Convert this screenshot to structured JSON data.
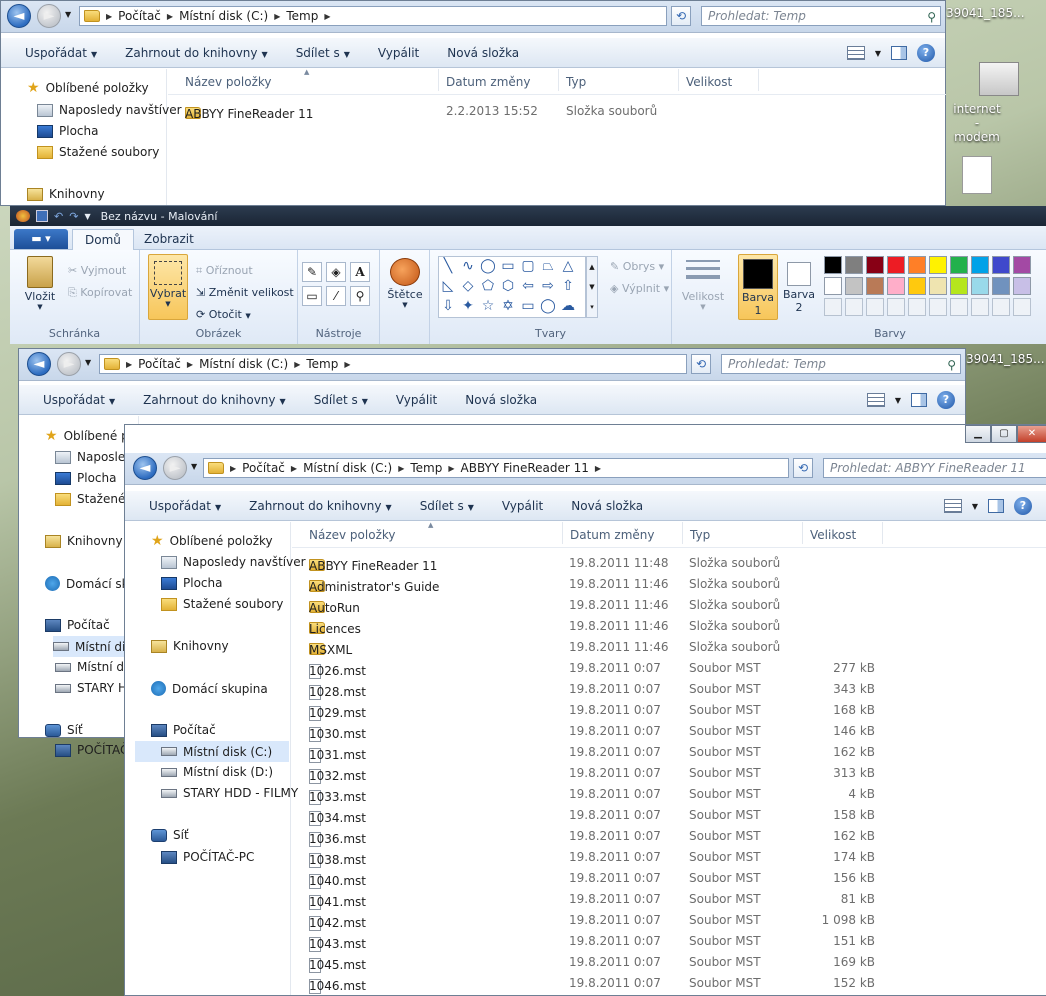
{
  "desktop": {
    "icon1_label": "internet -\nmodem",
    "fragment1": "39041_185...",
    "fragment2": "39041_185..."
  },
  "explorer1": {
    "path": [
      "Počítač",
      "Místní disk (C:)",
      "Temp"
    ],
    "search_placeholder": "Prohledat: Temp",
    "toolbar": [
      "Uspořádat",
      "Zahrnout do knihovny",
      "Sdílet s",
      "Vypálit",
      "Nová složka"
    ],
    "nav": [
      "Oblíbené položky",
      "Naposledy navštíver",
      "Plocha",
      "Stažené soubory",
      "Knihovny"
    ],
    "columns": [
      "Název položky",
      "Datum změny",
      "Typ",
      "Velikost"
    ],
    "rows": [
      {
        "name": "ABBYY FineReader 11",
        "date": "2.2.2013 15:52",
        "type": "Složka souborů",
        "size": ""
      }
    ]
  },
  "paint": {
    "title": "Bez názvu - Malování",
    "tabs": [
      "Domů",
      "Zobrazit"
    ],
    "groups": {
      "clipboard": {
        "label": "Schránka",
        "paste": "Vložit",
        "cut": "Vyjmout",
        "copy": "Kopírovat"
      },
      "image": {
        "label": "Obrázek",
        "select": "Vybrat",
        "crop": "Oříznout",
        "resize": "Změnit velikost",
        "rotate": "Otočit"
      },
      "tools": {
        "label": "Nástroje"
      },
      "brushes": {
        "label": "Štětce"
      },
      "shapes": {
        "label": "Tvary",
        "outline": "Obrys",
        "fill": "Výplnit"
      },
      "size": {
        "label": "Velikost"
      },
      "colors": {
        "label": "Barvy",
        "color1": "Barva\n1",
        "color2": "Barva\n2"
      }
    },
    "palette": [
      "#000000",
      "#7f7f7f",
      "#880015",
      "#ed1c24",
      "#ff7f27",
      "#fff200",
      "#22b14c",
      "#00a2e8",
      "#3f48cc",
      "#a349a4",
      "#ffffff",
      "#c3c3c3",
      "#b97a57",
      "#ffaec9",
      "#ffc90e",
      "#efe4b0",
      "#b5e61d",
      "#99d9ea",
      "#7092be",
      "#c8bfe7"
    ]
  },
  "explorer2": {
    "path": [
      "Počítač",
      "Místní disk (C:)",
      "Temp"
    ],
    "search_placeholder": "Prohledat: Temp",
    "toolbar": [
      "Uspořádat",
      "Zahrnout do knihovny",
      "Sdílet s",
      "Vypálit",
      "Nová složka"
    ],
    "nav": [
      "Oblíbené p",
      "Naposled",
      "Plocha",
      "Stažené s",
      "Knihovny",
      "Domácí sk",
      "Počítač",
      "Místní dis",
      "Místní dis",
      "STARY H",
      "Síť",
      "POČÍTAČ"
    ]
  },
  "explorer3": {
    "path": [
      "Počítač",
      "Místní disk (C:)",
      "Temp",
      "ABBYY FineReader 11"
    ],
    "search_placeholder": "Prohledat: ABBYY FineReader 11",
    "toolbar": [
      "Uspořádat",
      "Zahrnout do knihovny",
      "Sdílet s",
      "Vypálit",
      "Nová složka"
    ],
    "nav": {
      "favorites": "Oblíbené položky",
      "recent": "Naposledy navštíver",
      "desktop": "Plocha",
      "downloads": "Stažené soubory",
      "libraries": "Knihovny",
      "homegroup": "Domácí skupina",
      "computer": "Počítač",
      "driveC": "Místní disk (C:)",
      "driveD": "Místní disk (D:)",
      "hdd": "STARY HDD - FILMY",
      "network": "Síť",
      "pc": "POČÍTAČ-PC"
    },
    "columns": [
      "Název položky",
      "Datum změny",
      "Typ",
      "Velikost"
    ],
    "rows": [
      {
        "name": "ABBYY FineReader 11",
        "date": "19.8.2011 11:48",
        "type": "Složka souborů",
        "size": "",
        "folder": true
      },
      {
        "name": "Administrator's Guide",
        "date": "19.8.2011 11:46",
        "type": "Složka souborů",
        "size": "",
        "folder": true
      },
      {
        "name": "AutoRun",
        "date": "19.8.2011 11:46",
        "type": "Složka souborů",
        "size": "",
        "folder": true
      },
      {
        "name": "Licences",
        "date": "19.8.2011 11:46",
        "type": "Složka souborů",
        "size": "",
        "folder": true
      },
      {
        "name": "MSXML",
        "date": "19.8.2011 11:46",
        "type": "Složka souborů",
        "size": "",
        "folder": true
      },
      {
        "name": "1026.mst",
        "date": "19.8.2011 0:07",
        "type": "Soubor MST",
        "size": "277 kB"
      },
      {
        "name": "1028.mst",
        "date": "19.8.2011 0:07",
        "type": "Soubor MST",
        "size": "343 kB"
      },
      {
        "name": "1029.mst",
        "date": "19.8.2011 0:07",
        "type": "Soubor MST",
        "size": "168 kB"
      },
      {
        "name": "1030.mst",
        "date": "19.8.2011 0:07",
        "type": "Soubor MST",
        "size": "146 kB"
      },
      {
        "name": "1031.mst",
        "date": "19.8.2011 0:07",
        "type": "Soubor MST",
        "size": "162 kB"
      },
      {
        "name": "1032.mst",
        "date": "19.8.2011 0:07",
        "type": "Soubor MST",
        "size": "313 kB"
      },
      {
        "name": "1033.mst",
        "date": "19.8.2011 0:07",
        "type": "Soubor MST",
        "size": "4 kB"
      },
      {
        "name": "1034.mst",
        "date": "19.8.2011 0:07",
        "type": "Soubor MST",
        "size": "158 kB"
      },
      {
        "name": "1036.mst",
        "date": "19.8.2011 0:07",
        "type": "Soubor MST",
        "size": "162 kB"
      },
      {
        "name": "1038.mst",
        "date": "19.8.2011 0:07",
        "type": "Soubor MST",
        "size": "174 kB"
      },
      {
        "name": "1040.mst",
        "date": "19.8.2011 0:07",
        "type": "Soubor MST",
        "size": "156 kB"
      },
      {
        "name": "1041.mst",
        "date": "19.8.2011 0:07",
        "type": "Soubor MST",
        "size": "81 kB"
      },
      {
        "name": "1042.mst",
        "date": "19.8.2011 0:07",
        "type": "Soubor MST",
        "size": "1 098 kB"
      },
      {
        "name": "1043.mst",
        "date": "19.8.2011 0:07",
        "type": "Soubor MST",
        "size": "151 kB"
      },
      {
        "name": "1045.mst",
        "date": "19.8.2011 0:07",
        "type": "Soubor MST",
        "size": "169 kB"
      },
      {
        "name": "1046.mst",
        "date": "19.8.2011 0:07",
        "type": "Soubor MST",
        "size": "152 kB"
      }
    ]
  }
}
